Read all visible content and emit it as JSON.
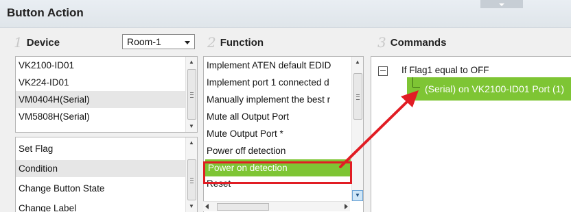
{
  "title": "Button Action",
  "columns": {
    "device": {
      "num": "1",
      "label": "Device"
    },
    "function": {
      "num": "2",
      "label": "Function"
    },
    "commands": {
      "num": "3",
      "label": "Commands"
    }
  },
  "room_select": {
    "value": "Room-1"
  },
  "devices": [
    "VK2100-ID01",
    "VK224-ID01",
    "VM0404H(Serial)",
    "VM5808H(Serial)"
  ],
  "actions": [
    "Set Flag",
    "Condition",
    "Change Button State",
    "Change Label"
  ],
  "functions": [
    "Implement ATEN default EDID",
    "Implement port 1 connected d",
    "Manually implement the best r",
    "Mute all Output Port",
    "Mute Output Port *",
    "Power off detection",
    "Power on detection",
    "Reset"
  ],
  "selected_function": "Power on detection",
  "commands_tree": {
    "root": "If Flag1 equal to OFF",
    "child": "(Serial) on VK2100-ID01 Port (1)"
  },
  "colors": {
    "selected": "#7ec534",
    "highlight_border": "#e11d24",
    "arrow": "#e11d24"
  }
}
